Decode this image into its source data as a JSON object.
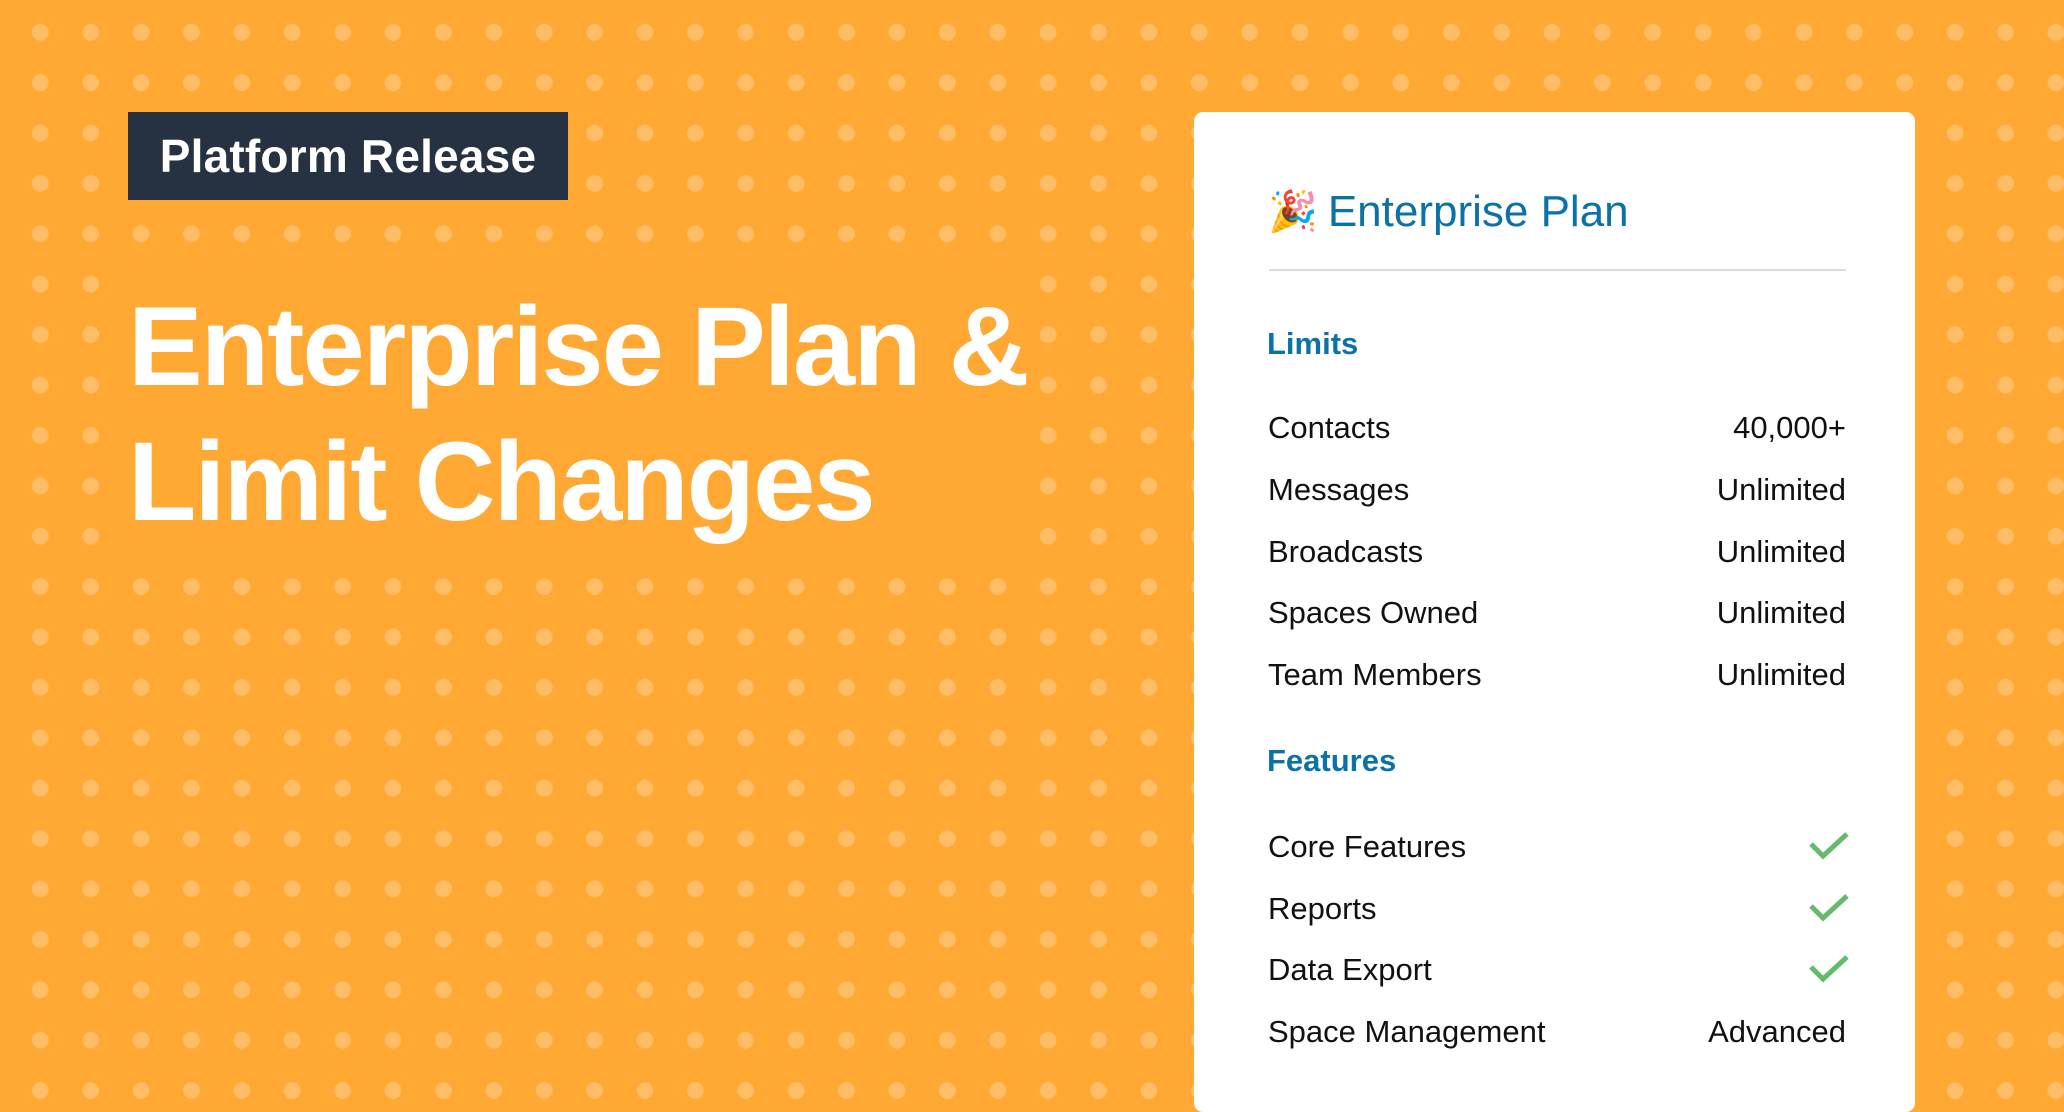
{
  "badge": {
    "label": "Platform Release"
  },
  "headline": {
    "line1": "Enterprise Plan &",
    "line2": "Limit Changes"
  },
  "card": {
    "emoji": "🎉",
    "title": "Enterprise Plan",
    "limits": {
      "heading": "Limits",
      "rows": [
        {
          "label": "Contacts",
          "value": "40,000+"
        },
        {
          "label": "Messages",
          "value": "Unlimited"
        },
        {
          "label": "Broadcasts",
          "value": "Unlimited"
        },
        {
          "label": "Spaces Owned",
          "value": "Unlimited"
        },
        {
          "label": "Team Members",
          "value": "Unlimited"
        }
      ]
    },
    "features": {
      "heading": "Features",
      "rows": [
        {
          "label": "Core Features",
          "value": null,
          "icon": "check-icon"
        },
        {
          "label": "Reports",
          "value": null,
          "icon": "check-icon"
        },
        {
          "label": "Data Export",
          "value": null,
          "icon": "check-icon"
        },
        {
          "label": "Space Management",
          "value": "Advanced"
        }
      ]
    }
  },
  "colors": {
    "background": "#ffa834",
    "badge": "#263241",
    "accent_blue": "#0b72a8",
    "check_green": "#66bb6a"
  }
}
